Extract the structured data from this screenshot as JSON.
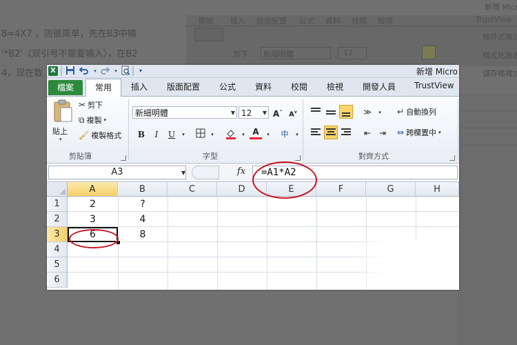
{
  "background": {
    "lines": [
      "8=4X7 ，则很简单，先在B3中输",
      "'*B2'（双引号不需要输入），在B2",
      "4，现在数"
    ],
    "tabs": [
      "開始",
      "插入",
      "版面配置",
      "公式",
      "資料",
      "校閱",
      "檢視",
      "TrustView"
    ],
    "top_right": "新增 Micro",
    "font_name": "新細明體",
    "font_size": "12",
    "ribbon_items": [
      "剪下",
      "條件式格式設定",
      "格式化為表格",
      "儲存格樣式"
    ]
  },
  "window": {
    "title": "新增 Micro",
    "logo": "X"
  },
  "quick_access": [
    "save-icon",
    "undo-icon",
    "redo-icon",
    "print-preview-icon"
  ],
  "ribbon": {
    "tabs": [
      "檔案",
      "常用",
      "插入",
      "版面配置",
      "公式",
      "資料",
      "校閱",
      "檢視",
      "開發人員",
      "TrustView"
    ],
    "active_tab": "常用",
    "clipboard": {
      "paste": "貼上",
      "cut": "剪下",
      "copy": "複製",
      "format_painter": "複製格式",
      "group": "剪貼簿"
    },
    "font": {
      "name": "新細明體",
      "size": "12",
      "bold": "B",
      "italic": "I",
      "underline": "U",
      "group": "字型"
    },
    "alignment": {
      "wrap": "自動換列",
      "merge": "跨欄置中",
      "group": "對齊方式"
    }
  },
  "formula_bar": {
    "name_box": "A3",
    "fx": "fx",
    "formula": "=A1*A2"
  },
  "sheet": {
    "columns": [
      "A",
      "B",
      "C",
      "D",
      "E",
      "F",
      "G",
      "H"
    ],
    "rows": [
      "1",
      "2",
      "3",
      "4",
      "5",
      "6"
    ],
    "active_column": "A",
    "active_row": "3",
    "cells": {
      "A1": "2",
      "B1": "?",
      "A2": "3",
      "B2": "4",
      "A3": "6",
      "B3": "8"
    }
  },
  "colors": {
    "annotation": "#c8141e",
    "file_tab": "#2d8a3b",
    "selection_header": "#f5cf6a"
  }
}
